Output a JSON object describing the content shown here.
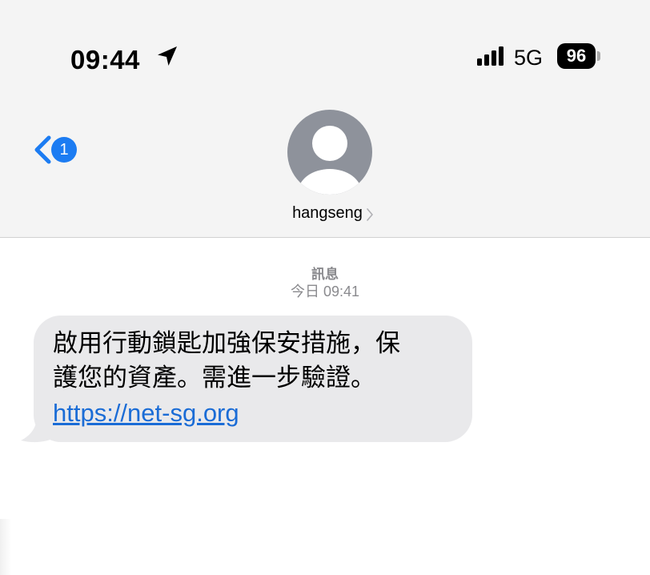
{
  "status_bar": {
    "time": "09:44",
    "location_icon": "location-arrow-icon",
    "signal_icon": "cellular-signal-icon",
    "network": "5G",
    "battery": "96"
  },
  "nav": {
    "back_icon": "chevron-left-icon",
    "unread_count": "1",
    "avatar_icon": "person-silhouette-icon",
    "contact_name": "hangseng",
    "contact_chevron_icon": "chevron-right-icon"
  },
  "conversation": {
    "label": "訊息",
    "timestamp": "今日 09:41",
    "message": {
      "line1": "啟用行動鎖匙加強保安措施，保",
      "line2": "護您的資產。需進一步驗證。",
      "link": "https://net-sg.org"
    }
  },
  "colors": {
    "accent_blue": "#1c7cf2",
    "link_blue": "#1a6cd6",
    "bubble_gray": "#e9e9eb",
    "header_bg": "#f4f4f4",
    "avatar_gray": "#8e929b"
  }
}
